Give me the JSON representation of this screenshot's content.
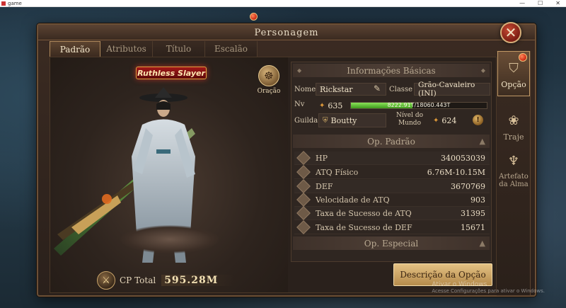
{
  "os": {
    "title": "game",
    "controls": [
      "—",
      "☐",
      "✕"
    ]
  },
  "panel": {
    "title": "Personagem"
  },
  "tabs": [
    {
      "label": "Padrão",
      "active": true
    },
    {
      "label": "Atributos",
      "active": false
    },
    {
      "label": "Título",
      "active": false
    },
    {
      "label": "Escalão",
      "active": false
    }
  ],
  "character": {
    "rank_badge": "Ruthless Slayer",
    "prayer_label": "Oração",
    "cp_label": "CP Total",
    "cp_value": "595.28M"
  },
  "basic_info": {
    "header": "Informações Básicas",
    "name_label": "Nome",
    "name_value": "Rickstar",
    "class_label": "Classe",
    "class_value": "Grão-Cavaleiro (INI)",
    "level_label": "Nv",
    "level_value": "635",
    "exp_text": "8222.91T/18060.443T",
    "exp_fraction": 0.455,
    "guild_label": "Guilda",
    "guild_value": "Boutty",
    "world_level_label": "Nível do Mundo",
    "world_level_value": "624",
    "info_icon": "!"
  },
  "standard_ops": {
    "header": "Op. Padrão",
    "stats": [
      {
        "label": "HP",
        "value": "340053039"
      },
      {
        "label": "ATQ Físico",
        "value": "6.76M-10.15M"
      },
      {
        "label": "DEF",
        "value": "3670769"
      },
      {
        "label": "Velocidade de ATQ",
        "value": "903"
      },
      {
        "label": "Taxa de Sucesso de ATQ",
        "value": "31395"
      },
      {
        "label": "Taxa de Sucesso de DEF",
        "value": "15671"
      }
    ]
  },
  "special_ops": {
    "header": "Op. Especial"
  },
  "description_button": "Descrição da Opção",
  "sidebar": [
    {
      "label": "Opção",
      "active": true
    },
    {
      "label": "Traje",
      "active": false
    },
    {
      "label": "Artefato da Alma",
      "active": false
    }
  ],
  "watermark": {
    "title": "Ativar o Windows",
    "text": "Acesse Configurações para ativar o Windows."
  },
  "colors": {
    "accent": "#c29a66",
    "exp_bar": "#5ec32f",
    "close": "#a3301f"
  }
}
